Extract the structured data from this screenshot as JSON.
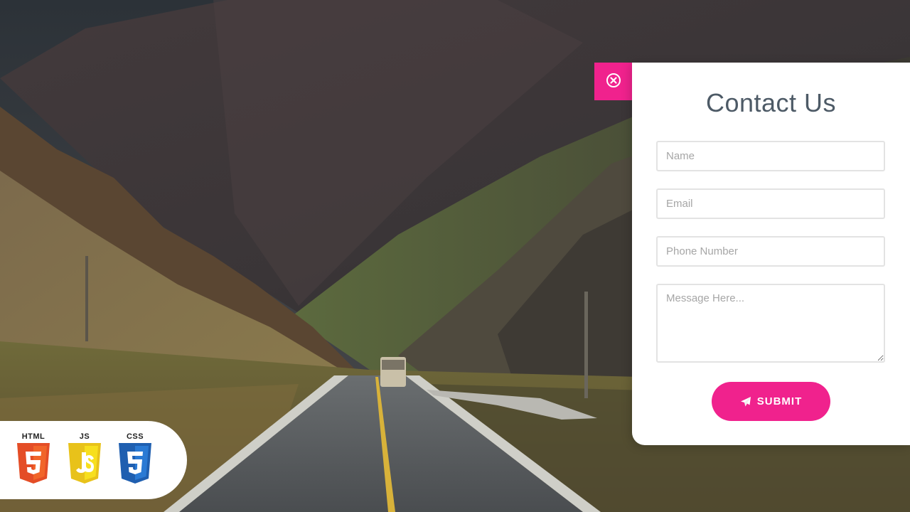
{
  "contact_form": {
    "title": "Contact Us",
    "name_placeholder": "Name",
    "email_placeholder": "Email",
    "phone_placeholder": "Phone Number",
    "message_placeholder": "Message Here...",
    "submit_label": "SUBMIT",
    "close_icon": "close-circle-icon",
    "submit_icon": "paper-plane-icon"
  },
  "tech_badge": {
    "items": [
      {
        "label": "HTML",
        "icon": "html5-icon",
        "color": "#e44d26"
      },
      {
        "label": "JS",
        "icon": "js-icon",
        "color": "#f0d31f"
      },
      {
        "label": "CSS",
        "icon": "css3-icon",
        "color": "#2a6fc4"
      }
    ]
  },
  "colors": {
    "accent": "#f0228d",
    "panel_bg": "#ffffff",
    "title_text": "#4d5a66",
    "field_border": "#e3e3e3"
  }
}
